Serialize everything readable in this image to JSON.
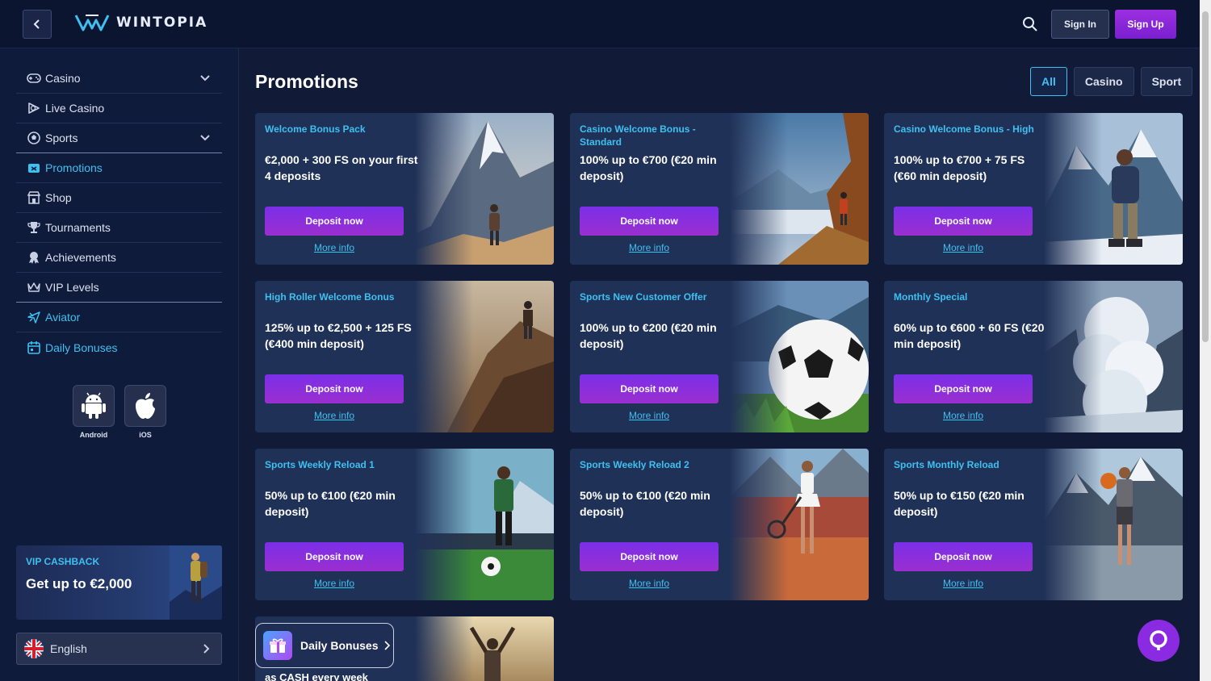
{
  "header": {
    "logo_text": "WINTOPIA",
    "signin_label": "Sign In",
    "signup_label": "Sign Up"
  },
  "sidebar": {
    "items": [
      {
        "label": "Casino",
        "icon": "gamepad-icon",
        "expandable": true
      },
      {
        "label": "Live Casino",
        "icon": "live-casino-icon"
      },
      {
        "label": "Sports",
        "icon": "soccer-ball-icon",
        "expandable": true
      },
      {
        "label": "Promotions",
        "icon": "promotions-icon",
        "active": true
      },
      {
        "label": "Shop",
        "icon": "shop-icon"
      },
      {
        "label": "Tournaments",
        "icon": "trophy-icon"
      },
      {
        "label": "Achievements",
        "icon": "achievement-icon"
      },
      {
        "label": "VIP Levels",
        "icon": "crown-icon"
      },
      {
        "label": "Aviator",
        "icon": "plane-icon",
        "active": true
      },
      {
        "label": "Daily Bonuses",
        "icon": "calendar-icon",
        "active": true
      }
    ],
    "apps": [
      {
        "label": "Android",
        "icon": "android-icon"
      },
      {
        "label": "iOS",
        "icon": "apple-icon"
      }
    ],
    "vip_cashback": {
      "title": "VIP CASHBACK",
      "text": "Get up to €2,000"
    },
    "language": "English"
  },
  "main": {
    "title": "Promotions",
    "filters": [
      {
        "label": "All",
        "active": true
      },
      {
        "label": "Casino"
      },
      {
        "label": "Sport"
      }
    ],
    "cards": [
      {
        "title": "Welcome Bonus Pack",
        "offer": "€2,000 + 300 FS on your first 4 deposits",
        "button": "Deposit now",
        "link": "More info",
        "image": "mountain-hiker"
      },
      {
        "title": "Casino Welcome Bonus - Standard",
        "offer": "100% up to €700 (€20 min deposit)",
        "button": "Deposit now",
        "link": "More info",
        "image": "cliff-hiker"
      },
      {
        "title": "Casino Welcome Bonus - High",
        "offer": "100% up to €700 + 75 FS (€60 min deposit)",
        "button": "Deposit now",
        "link": "More info",
        "image": "snow-climber"
      },
      {
        "title": "High Roller Welcome Bonus",
        "offer": "125% up to €2,500 + 125 FS (€400 min deposit)",
        "button": "Deposit now",
        "link": "More info",
        "image": "rock-climber"
      },
      {
        "title": "Sports New Customer Offer",
        "offer": "100% up to €200 (€20 min deposit)",
        "button": "Deposit now",
        "link": "More info",
        "image": "soccer-ball"
      },
      {
        "title": "Monthly Special",
        "offer": "60% up to €600 + 60 FS (€20 min deposit)",
        "button": "Deposit now",
        "link": "More info",
        "image": "avalanche"
      },
      {
        "title": "Sports Weekly Reload 1",
        "offer": "50% up to €100 (€20 min deposit)",
        "button": "Deposit now",
        "link": "More info",
        "image": "soccer-player"
      },
      {
        "title": "Sports Weekly Reload 2",
        "offer": "50% up to €100 (€20 min deposit)",
        "button": "Deposit now",
        "link": "More info",
        "image": "tennis-player"
      },
      {
        "title": "Sports Monthly Reload",
        "offer": "50% up to €150 (€20 min deposit)",
        "button": "Deposit now",
        "link": "More info",
        "image": "basketball-player"
      }
    ],
    "daily_card": {
      "pill_label": "Daily Bonuses",
      "subtitle": "as CASH every week"
    }
  }
}
